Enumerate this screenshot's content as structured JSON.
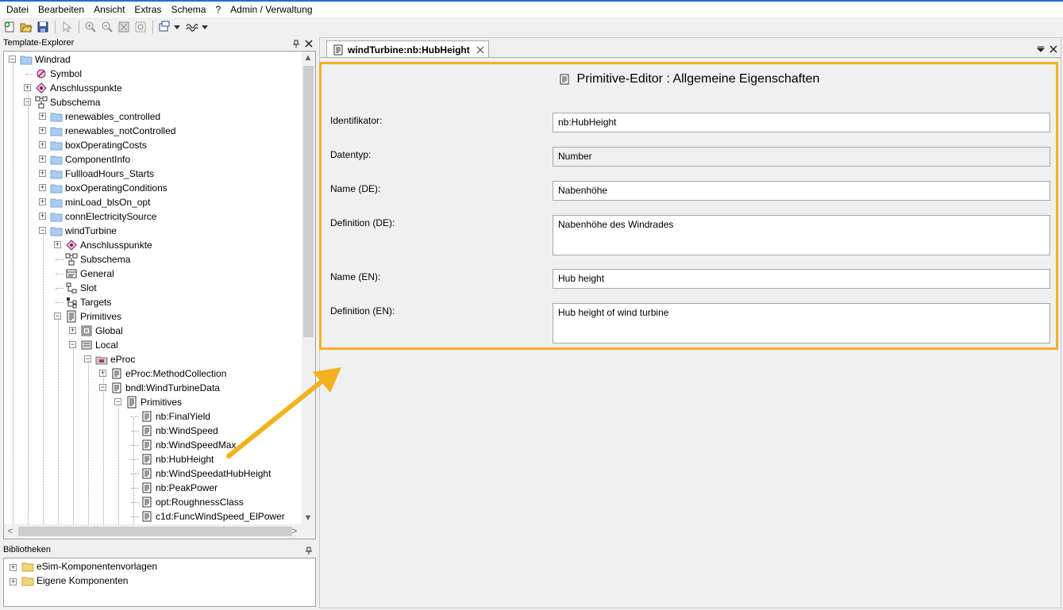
{
  "menu": [
    "Datei",
    "Bearbeiten",
    "Ansicht",
    "Extras",
    "Schema",
    "?",
    "Admin / Verwaltung"
  ],
  "toolbar": {
    "icons": [
      "new-icon",
      "open-icon",
      "save-icon",
      "pointer-icon",
      "zoom-in-icon",
      "zoom-out-icon",
      "zoom-fit-icon",
      "zoom-select-icon",
      "layout-icon",
      "wave-icon"
    ]
  },
  "template_explorer": {
    "title": "Template-Explorer",
    "items": [
      {
        "label": "Windrad",
        "icon": "folder-icon",
        "expander": "-"
      },
      {
        "label": "Symbol",
        "icon": "symbol-icon",
        "expander": ""
      },
      {
        "label": "Anschlusspunkte",
        "icon": "connector-icon",
        "expander": "+"
      },
      {
        "label": "Subschema",
        "icon": "subschema-icon",
        "expander": "-"
      },
      {
        "label": "renewables_controlled",
        "icon": "folder-icon",
        "expander": "+"
      },
      {
        "label": "renewables_notControlled",
        "icon": "folder-icon",
        "expander": "+"
      },
      {
        "label": "boxOperatingCosts",
        "icon": "folder-icon",
        "expander": "+"
      },
      {
        "label": "ComponentInfo",
        "icon": "folder-icon",
        "expander": "+"
      },
      {
        "label": "FullloadHours_Starts",
        "icon": "folder-icon",
        "expander": "+"
      },
      {
        "label": "boxOperatingConditions",
        "icon": "folder-icon",
        "expander": "+"
      },
      {
        "label": "minLoad_blsOn_opt",
        "icon": "folder-icon",
        "expander": "+"
      },
      {
        "label": "connElectricitySource",
        "icon": "folder-icon",
        "expander": "+"
      },
      {
        "label": "windTurbine",
        "icon": "folder-icon",
        "expander": "-"
      },
      {
        "label": "Anschlusspunkte",
        "icon": "connector-icon",
        "expander": "+"
      },
      {
        "label": "Subschema",
        "icon": "subschema-icon",
        "expander": ""
      },
      {
        "label": "General",
        "icon": "general-icon",
        "expander": ""
      },
      {
        "label": "Slot",
        "icon": "slot-icon",
        "expander": ""
      },
      {
        "label": "Targets",
        "icon": "targets-icon",
        "expander": ""
      },
      {
        "label": "Primitives",
        "icon": "primitives-icon",
        "expander": "-"
      },
      {
        "label": "Global",
        "icon": "global-icon",
        "expander": "+"
      },
      {
        "label": "Local",
        "icon": "local-icon",
        "expander": "-"
      },
      {
        "label": "eProc",
        "icon": "eproc-icon",
        "expander": "-"
      },
      {
        "label": "eProc:MethodCollection",
        "icon": "doc-icon",
        "expander": "+"
      },
      {
        "label": "bndl:WindTurbineData",
        "icon": "doc-icon",
        "expander": "-"
      },
      {
        "label": "Primitives",
        "icon": "primitives-icon",
        "expander": "-"
      },
      {
        "label": "nb:FinalYield",
        "icon": "doc-icon",
        "expander": ""
      },
      {
        "label": "nb:WindSpeed",
        "icon": "doc-icon",
        "expander": ""
      },
      {
        "label": "nb:WindSpeedMax",
        "icon": "doc-icon",
        "expander": ""
      },
      {
        "label": "nb:HubHeight",
        "icon": "doc-icon",
        "expander": ""
      },
      {
        "label": "nb:WindSpeedatHubHeight",
        "icon": "doc-icon",
        "expander": ""
      },
      {
        "label": "nb:PeakPower",
        "icon": "doc-icon",
        "expander": ""
      },
      {
        "label": "opt:RoughnessClass",
        "icon": "doc-icon",
        "expander": ""
      },
      {
        "label": "c1d:FuncWindSpeed_ElPower",
        "icon": "doc-icon",
        "expander": ""
      }
    ]
  },
  "bibliotheken": {
    "title": "Bibliotheken",
    "items": [
      {
        "label": "eSim-Komponentenvorlagen",
        "icon": "library-folder-icon"
      },
      {
        "label": "Eigene Komponenten",
        "icon": "library-folder-icon"
      }
    ]
  },
  "editor": {
    "tab_label": "windTurbine:nb:HubHeight",
    "title": "Primitive-Editor : Allgemeine Eigenschaften",
    "fields": [
      {
        "label": "Identifikator:",
        "value": "nb:HubHeight"
      },
      {
        "label": "Datentyp:",
        "value": "Number"
      },
      {
        "label": "Name (DE):",
        "value": "Nabenhöhe"
      },
      {
        "label": "Definition (DE):",
        "value": "Nabenhöhe des Windrades"
      },
      {
        "label": "Name (EN):",
        "value": "Hub height"
      },
      {
        "label": "Definition (EN):",
        "value": "Hub height of wind turbine"
      }
    ]
  },
  "colors": {
    "highlight_frame": "#f2b21f",
    "folder": "#a9cdf0",
    "library_folder": "#f5d37a"
  }
}
